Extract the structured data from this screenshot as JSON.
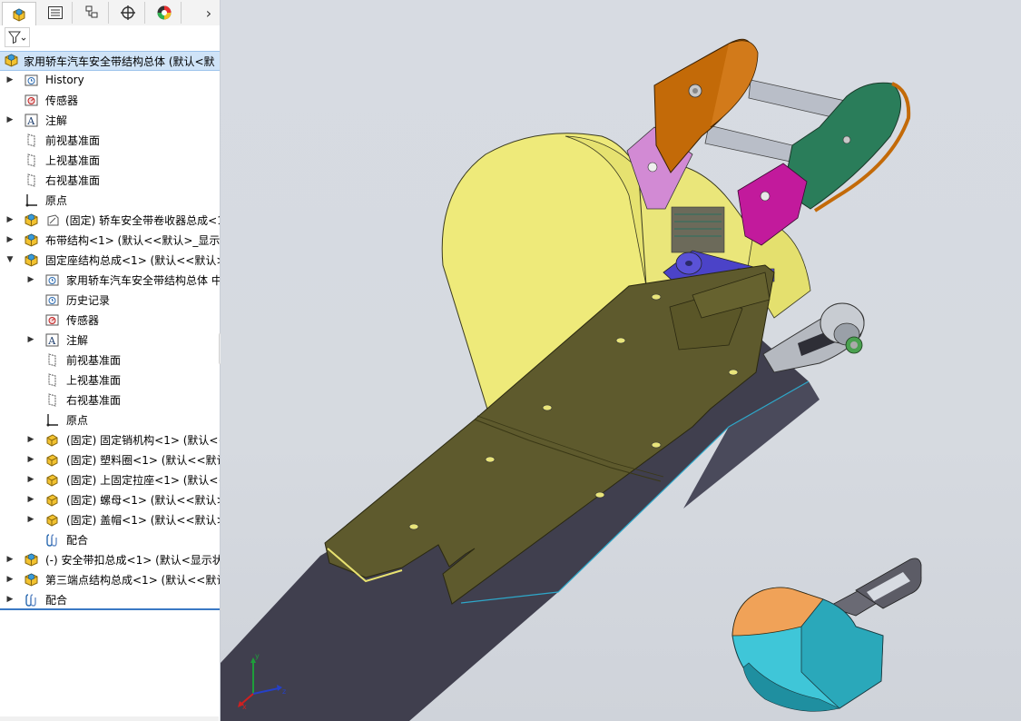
{
  "tabs": [
    {
      "name": "featuremanager-tab",
      "icon": "assembly-icon",
      "active": true
    },
    {
      "name": "propertymanager-tab",
      "icon": "property-list-icon",
      "active": false
    },
    {
      "name": "configurationmanager-tab",
      "icon": "configuration-icon",
      "active": false
    },
    {
      "name": "dimxpert-tab",
      "icon": "crosshair-icon",
      "active": false
    },
    {
      "name": "display-manager-tab",
      "icon": "color-wheel-icon",
      "active": false
    }
  ],
  "tabs_more": "›",
  "filter_icon": "filter-icon",
  "tree": {
    "root": "家用轿车汽车安全带结构总体 (默认<默",
    "items": [
      {
        "label": "History",
        "icon": "history-icon",
        "level": 1,
        "expandable": true
      },
      {
        "label": "传感器",
        "icon": "sensor-icon",
        "level": 1,
        "expandable": false
      },
      {
        "label": "注解",
        "icon": "annotation-icon",
        "level": 1,
        "expandable": true
      },
      {
        "label": "前视基准面",
        "icon": "plane-icon",
        "level": 1,
        "expandable": false
      },
      {
        "label": "上视基准面",
        "icon": "plane-icon",
        "level": 1,
        "expandable": false
      },
      {
        "label": "右视基准面",
        "icon": "plane-icon",
        "level": 1,
        "expandable": false
      },
      {
        "label": "原点",
        "icon": "origin-icon",
        "level": 1,
        "expandable": false
      },
      {
        "label": "(固定) 轿车安全带卷收器总成<1",
        "icon": "subassembly-icon",
        "level": 1,
        "expandable": true,
        "extra_icon": "sketch-icon"
      },
      {
        "label": "布带结构<1> (默认<<默认>_显示北",
        "icon": "subassembly-icon",
        "level": 1,
        "expandable": true
      },
      {
        "label": "固定座结构总成<1> (默认<<默认>",
        "icon": "subassembly-icon",
        "level": 1,
        "expandable": true,
        "expanded": true
      },
      {
        "label": "家用轿车汽车安全带结构总体 中",
        "icon": "history-icon",
        "level": 2,
        "expandable": true
      },
      {
        "label": "历史记录",
        "icon": "history-icon",
        "level": 2,
        "expandable": false
      },
      {
        "label": "传感器",
        "icon": "sensor-icon",
        "level": 2,
        "expandable": false
      },
      {
        "label": "注解",
        "icon": "annotation-icon",
        "level": 2,
        "expandable": true
      },
      {
        "label": "前视基准面",
        "icon": "plane-icon",
        "level": 2,
        "expandable": false
      },
      {
        "label": "上视基准面",
        "icon": "plane-icon",
        "level": 2,
        "expandable": false
      },
      {
        "label": "右视基准面",
        "icon": "plane-icon",
        "level": 2,
        "expandable": false
      },
      {
        "label": "原点",
        "icon": "origin-icon",
        "level": 2,
        "expandable": false
      },
      {
        "label": "(固定) 固定销机构<1> (默认<<",
        "icon": "part-icon",
        "level": 2,
        "expandable": true
      },
      {
        "label": "(固定) 塑料圈<1> (默认<<默认>",
        "icon": "part-icon",
        "level": 2,
        "expandable": true
      },
      {
        "label": "(固定) 上固定拉座<1> (默认<<",
        "icon": "part-icon",
        "level": 2,
        "expandable": true
      },
      {
        "label": "(固定) 螺母<1> (默认<<默认>",
        "icon": "part-icon",
        "level": 2,
        "expandable": true
      },
      {
        "label": "(固定) 盖帽<1> (默认<<默认>",
        "icon": "part-icon",
        "level": 2,
        "expandable": true
      },
      {
        "label": "配合",
        "icon": "mates-icon",
        "level": 2,
        "expandable": false
      },
      {
        "label": "(-) 安全带扣总成<1> (默认<显示状",
        "icon": "subassembly-icon",
        "level": 1,
        "expandable": true
      },
      {
        "label": "第三端点结构总成<1> (默认<<默认",
        "icon": "subassembly-icon",
        "level": 1,
        "expandable": true
      },
      {
        "label": "配合",
        "icon": "mates-icon",
        "level": 1,
        "expandable": true
      }
    ]
  },
  "triad": {
    "x": "x",
    "y": "y",
    "z": "z"
  },
  "colors": {
    "housing_yellow": "#eeea7a",
    "plate_olive": "#5e5a2d",
    "webbing_dark": "#403f4e",
    "arm_orange": "#c36a08",
    "arm_green": "#2a7d5a",
    "link_magenta": "#c21a9c",
    "link_violet": "#d28ad4",
    "pin_blue": "#4b43c8",
    "buckle_cyan": "#3fc6d8",
    "buckle_orange": "#f0a258",
    "selection_blue": "#cfe3f7"
  }
}
